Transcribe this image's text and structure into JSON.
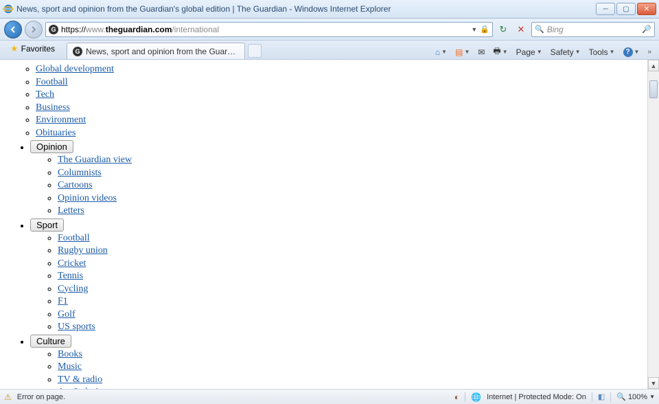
{
  "window": {
    "title": "News, sport and opinion from the Guardian's global edition | The Guardian - Windows Internet Explorer"
  },
  "address": {
    "protocol": "https://",
    "subdomain": "www.",
    "domain": "theguardian.com",
    "path": "/international"
  },
  "search": {
    "placeholder": "Bing"
  },
  "favorites_label": "Favorites",
  "tab": {
    "title": "News, sport and opinion from the Guardian's glo..."
  },
  "commandbar": {
    "page": "Page",
    "safety": "Safety",
    "tools": "Tools"
  },
  "nav": {
    "pre_items": [
      "Global development",
      "Football",
      "Tech",
      "Business",
      "Environment",
      "Obituaries"
    ],
    "sections": [
      {
        "label": "Opinion",
        "items": [
          "The Guardian view",
          "Columnists",
          "Cartoons",
          "Opinion videos",
          "Letters"
        ]
      },
      {
        "label": "Sport",
        "items": [
          "Football",
          "Rugby union",
          "Cricket",
          "Tennis",
          "Cycling",
          "F1",
          "Golf",
          "US sports"
        ]
      },
      {
        "label": "Culture",
        "items": [
          "Books",
          "Music",
          "TV & radio",
          "Art & design"
        ]
      }
    ]
  },
  "status": {
    "error": "Error on page.",
    "zone": "Internet | Protected Mode: On",
    "zoom": "100%"
  }
}
